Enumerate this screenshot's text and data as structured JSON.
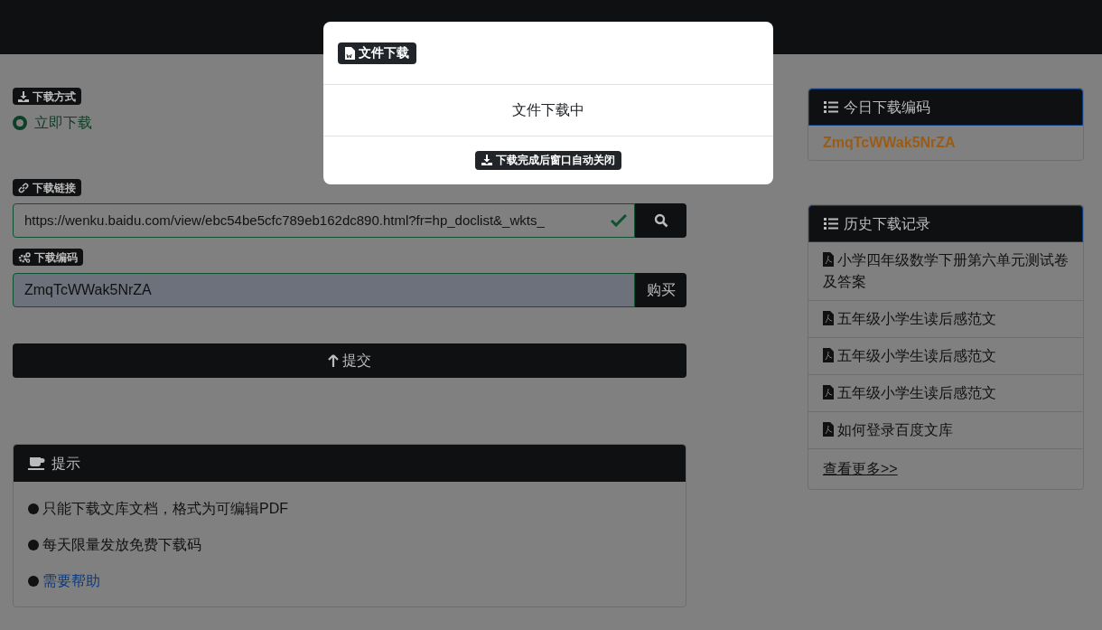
{
  "modal": {
    "title": "文件下载",
    "message": "文件下载中",
    "note": "下载完成后窗口自动关闭"
  },
  "download_method": {
    "label": "下载方式",
    "options": [
      {
        "label": "立即下载",
        "selected": true
      }
    ]
  },
  "link": {
    "label": "下载链接",
    "value": "https://wenku.baidu.com/view/ebc54be5cfc789eb162dc890.html?fr=hp_doclist&_wkts_",
    "valid": true
  },
  "code": {
    "label": "下载编码",
    "value": "ZmqTcWWak5NrZA",
    "button": "购买"
  },
  "submit": "提交",
  "tips": {
    "title": "提示",
    "items": [
      {
        "kind": "text",
        "text": "只能下载文库文档，格式为可编辑PDF"
      },
      {
        "kind": "text",
        "text": "每天限量发放免费下载码"
      },
      {
        "kind": "link",
        "text": "需要帮助"
      }
    ]
  },
  "today": {
    "title": "今日下载编码",
    "code": "ZmqTcWWak5NrZA"
  },
  "history": {
    "title": "历史下载记录",
    "items": [
      "小学四年级数学下册第六单元测试卷及答案",
      "五年级小学生读后感范文",
      "五年级小学生读后感范文",
      "五年级小学生读后感范文",
      "如何登录百度文库"
    ],
    "more": "查看更多>>"
  }
}
